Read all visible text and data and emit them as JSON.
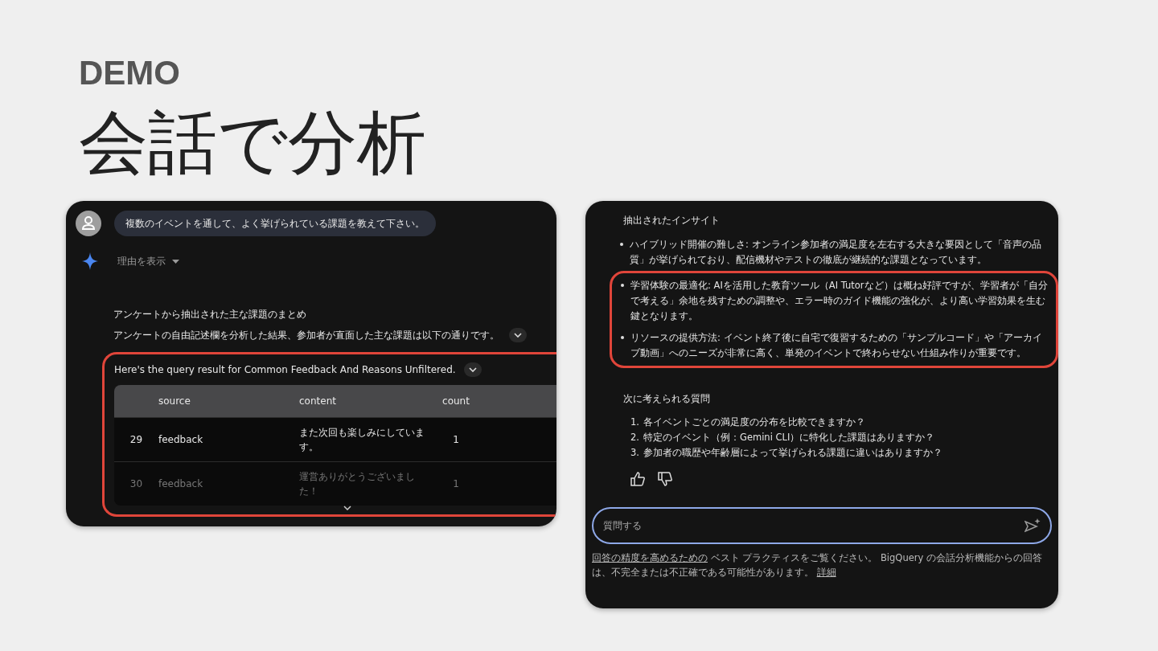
{
  "slide": {
    "eyebrow": "DEMO",
    "title": "会話で分析"
  },
  "left_panel": {
    "user_message": "複数のイベントを通して、よく挙げられている課題を教えて下さい。",
    "reasoning_toggle": "理由を表示",
    "summary_title": "アンケートから抽出された主な課題のまとめ",
    "summary_text": "アンケートの自由記述欄を分析した結果、参加者が直面した主な課題は以下の通りです。",
    "query_result": {
      "highlighted": true,
      "caption": "Here's the query result for Common Feedback And Reasons Unfiltered.",
      "columns": [
        "source",
        "content",
        "count"
      ],
      "rows": [
        {
          "index": "29",
          "source": "feedback",
          "content": "また次回も楽しみにしています。",
          "count": "1"
        },
        {
          "index": "30",
          "source": "feedback",
          "content": "運営ありがとうございました！",
          "count": "1"
        }
      ]
    }
  },
  "right_panel": {
    "insights_title": "抽出されたインサイト",
    "insights": [
      {
        "text": "ハイブリッド開催の難しさ: オンライン参加者の満足度を左右する大きな要因として「音声の品質」が挙げられており、配信機材やテストの徹底が継続的な課題となっています。",
        "highlighted": false
      },
      {
        "text": "学習体験の最適化: AIを活用した教育ツール（AI Tutorなど）は概ね好評ですが、学習者が「自分で考える」余地を残すための調整や、エラー時のガイド機能の強化が、より高い学習効果を生む鍵となります。",
        "highlighted": true
      },
      {
        "text": "リソースの提供方法: イベント終了後に自宅で復習するための「サンプルコード」や「アーカイブ動画」へのニーズが非常に高く、単発のイベントで終わらせない仕組み作りが重要です。",
        "highlighted": true
      }
    ],
    "next_questions_title": "次に考えられる質問",
    "next_questions": [
      {
        "number": "1.",
        "text": "各イベントごとの満足度の分布を比較できますか？"
      },
      {
        "number": "2.",
        "text": "特定のイベント（例：Gemini CLI）に特化した課題はありますか？"
      },
      {
        "number": "3.",
        "text": "参加者の職歴や年齢層によって挙げられる課題に違いはありますか？"
      }
    ],
    "input": {
      "placeholder": "質問する"
    },
    "footer": {
      "link": "回答の精度を高めるための",
      "text": " ベスト プラクティスをご覧ください。 BigQuery の会話分析機能からの回答は、不完全または不正確である可能性があります。",
      "details_link": "詳細"
    }
  }
}
